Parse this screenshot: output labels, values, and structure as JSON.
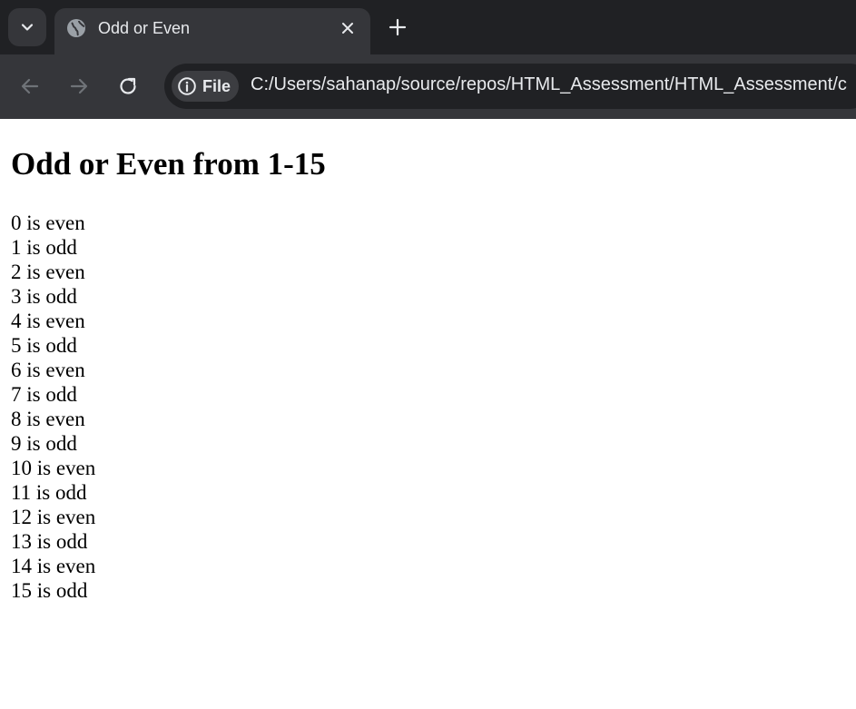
{
  "browser": {
    "tab": {
      "title": "Odd or Even",
      "favicon": "globe-icon"
    },
    "address_bar": {
      "site_chip_label": "File",
      "url": "C:/Users/sahanap/source/repos/HTML_Assessment/HTML_Assessment/c"
    },
    "colors": {
      "frame": "#202124",
      "toolbar": "#35363a",
      "text": "#e8eaed"
    }
  },
  "page": {
    "title": "Odd or Even from 1-15",
    "results": [
      "0 is even",
      "1 is odd",
      "2 is even",
      "3 is odd",
      "4 is even",
      "5 is odd",
      "6 is even",
      "7 is odd",
      "8 is even",
      "9 is odd",
      "10 is even",
      "11 is odd",
      "12 is even",
      "13 is odd",
      "14 is even",
      "15 is odd"
    ]
  }
}
